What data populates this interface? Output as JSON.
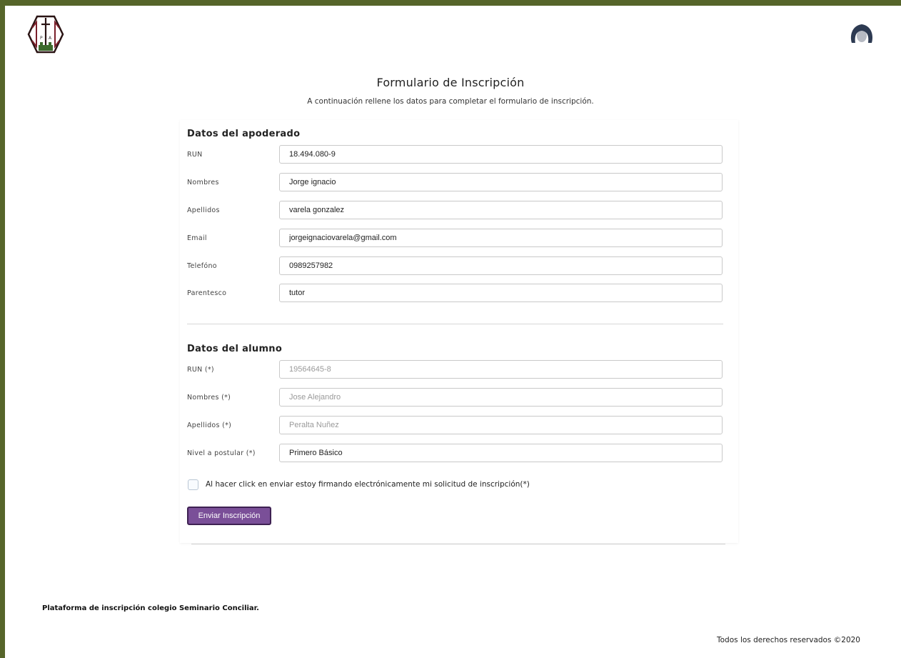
{
  "header": {
    "logo_icon": "school-crest-icon",
    "logo_letters": [
      "P",
      "A"
    ],
    "user_icon": "user-avatar-icon"
  },
  "page": {
    "title": "Formulario de Inscripción",
    "subtitle": "A continuación rellene los datos para completar el formulario de inscripción."
  },
  "guardian": {
    "section_title": "Datos del apoderado",
    "fields": [
      {
        "label": "RUN",
        "value": "18.494.080-9"
      },
      {
        "label": "Nombres",
        "value": "Jorge ignacio"
      },
      {
        "label": "Apellidos",
        "value": "varela gonzalez"
      },
      {
        "label": "Email",
        "value": "jorgeignaciovarela@gmail.com"
      },
      {
        "label": "Telefóno",
        "value": "0989257982"
      },
      {
        "label": "Parentesco",
        "value": "tutor"
      }
    ]
  },
  "student": {
    "section_title": "Datos del alumno",
    "fields": [
      {
        "label": "RUN (*)",
        "value": "",
        "placeholder": "19564645-8"
      },
      {
        "label": "Nombres (*)",
        "value": "",
        "placeholder": "Jose Alejandro"
      },
      {
        "label": "Apellidos (*)",
        "value": "",
        "placeholder": "Peralta Nuñez"
      },
      {
        "label": "Nivel a postular (*)",
        "value": "Primero Básico"
      }
    ]
  },
  "consent": {
    "checked": false,
    "label": "Al hacer click en enviar estoy firmando electrónicamente mi solicitud de inscripción(*)"
  },
  "submit": {
    "label": "Enviar Inscripción"
  },
  "footer": {
    "left": "Plataforma de inscripción colegio Seminario Conciliar.",
    "right": "Todos los derechos reservados ©2020"
  },
  "colors": {
    "frame": "#56652a",
    "button": "#7a4f98",
    "button_border": "#3e2152",
    "crest_dark": "#3b1a1a",
    "crest_green": "#3d6b2d"
  }
}
